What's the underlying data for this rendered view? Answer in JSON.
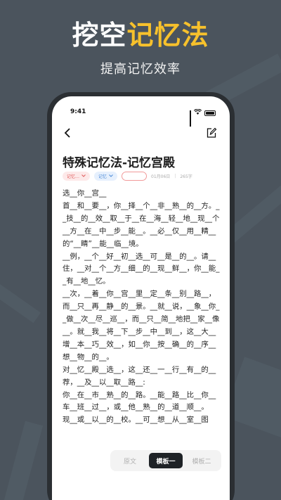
{
  "hero": {
    "title_prefix": "挖空",
    "title_highlight": "记忆法",
    "subtitle": "提高记忆效率"
  },
  "status": {
    "time": "9:41"
  },
  "article": {
    "title": "特殊记忆法-记忆宫殿",
    "tag1": "记忆…",
    "tag2": "记忆",
    "date": "01月06日",
    "separator": "|",
    "word_count": "265字",
    "body": "选__你__宫__\n首__和__要__，你__择__个__非__熟__的__方。__技__的__效__取__于__在__海__轻__地__现__个__方__在__中__步__能__。__必__仅__用__精__的“__睛”__能__临__境。\n__例，__个__好__初__选__可__是__的__。请__住，__对__个__方__细__的__现__鲜__，你__能__有__地__忆。\n__次，__着__你__宫__里__定__条__别__路__，而__只__再__静__的__景。__就__说，__象__你__做__次__尽__巡__，而__只__简__地把__家__像__。就__我__将__下__步__中__到__，这__大__增__本__巧__效__，如__你__按__确__的__序__想__物__的__。\n对__忆__殿__选__，这__还__一__行__有__的__荐，__及__以__取__路__:\n你__在__市__熟__的__路。__能__路__比__你__车__班__过__，或__他__熟__的__道__顺__。\n现__或__以__的__校。__可__想__从__室__图"
  },
  "modes": {
    "m1": "原文",
    "m2": "模板一",
    "m3": "模板二"
  },
  "colors": {
    "accent": "#f7c12c",
    "background": "#4b545d",
    "active_mode": "#1e2226"
  }
}
